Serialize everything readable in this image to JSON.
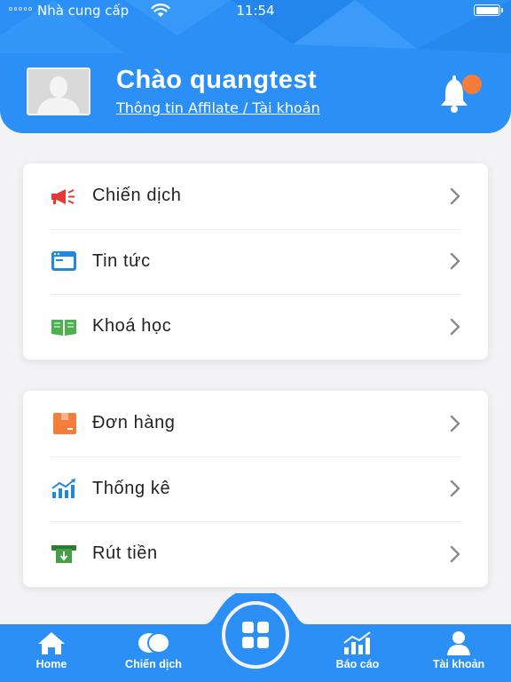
{
  "status_bar": {
    "carrier": "Nhà cung cấp",
    "time": "11:54"
  },
  "header": {
    "greeting": "Chào quangtest",
    "subtitle": "Thông tin Affilate / Tài khoản",
    "icons": [
      "avatar-placeholder",
      "bell-icon"
    ]
  },
  "menu_groups": [
    {
      "items": [
        {
          "label": "Chiến dịch",
          "icon": "megaphone-icon",
          "color": "#e53935"
        },
        {
          "label": "Tin tức",
          "icon": "browser-window-icon",
          "color": "#1e88e5"
        },
        {
          "label": "Khoá học",
          "icon": "open-book-icon",
          "color": "#4caf50"
        }
      ]
    },
    {
      "items": [
        {
          "label": "Đơn hàng",
          "icon": "package-box-icon",
          "color": "#f57c3a"
        },
        {
          "label": "Thống kê",
          "icon": "growth-chart-icon",
          "color": "#1e88e5"
        },
        {
          "label": "Rút tiền",
          "icon": "cash-withdraw-icon",
          "color": "#43a047"
        }
      ]
    }
  ],
  "bottom_nav": {
    "items": [
      {
        "label": "Home",
        "icon": "home-icon"
      },
      {
        "label": "Chiến dịch",
        "icon": "campaign-bubbles-icon"
      },
      {
        "label": "Báo cáo",
        "icon": "bar-chart-icon"
      },
      {
        "label": "Tài khoản",
        "icon": "user-icon"
      }
    ],
    "center_icon": "grid-icon"
  },
  "colors": {
    "primary": "#2c8ff5",
    "background": "#f3f3f5",
    "notification_dot": "#f57c3a"
  }
}
